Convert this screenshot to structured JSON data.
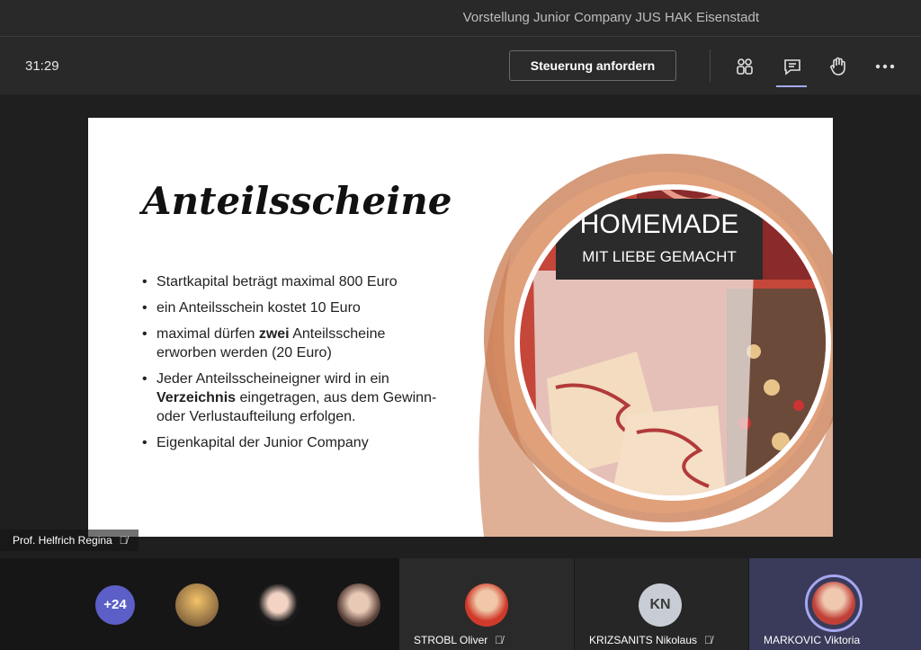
{
  "window": {
    "title": "Vorstellung Junior Company JUS HAK Eisenstadt"
  },
  "toolbar": {
    "timer": "31:29",
    "request_control_label": "Steuerung anfordern",
    "icons": [
      "participants-icon",
      "chat-icon",
      "raise-hand-icon",
      "more-icon"
    ]
  },
  "slide": {
    "title": "Anteilsscheine",
    "bullets": [
      {
        "text": "Startkapital beträgt maximal 800 Euro"
      },
      {
        "text": "ein Anteilsschein kostet 10 Euro"
      },
      {
        "pre": "maximal dürfen ",
        "bold": "zwei",
        "post": " Anteilsscheine erworben werden (20 Euro)"
      },
      {
        "pre": "Jeder Anteilsscheineigner wird in ein ",
        "bold": "Verzeichnis",
        "post": " eingetragen, aus dem Gewinn- oder Verlustaufteilung erfolgen."
      },
      {
        "text": "Eigenkapital der Junior Company"
      }
    ],
    "image_sign_line1": "HOMEMADE",
    "image_sign_line2": "MIT LIEBE GEMACHT"
  },
  "presenter": {
    "name": "Prof. Helfrich Regina",
    "muted_icon": "mic-off-icon"
  },
  "participants": {
    "more_count": "+24",
    "tiles": [
      {
        "name": "STROBL Oliver",
        "muted": true
      },
      {
        "name": "KRIZSANITS Nikolaus",
        "initials": "KN",
        "muted": true
      },
      {
        "name": "MARKOVIC Viktoria",
        "speaking": true
      }
    ]
  },
  "colors": {
    "accent": "#5b5fc7",
    "ring": "#a5a8f0",
    "background": "#1f1f1f"
  }
}
